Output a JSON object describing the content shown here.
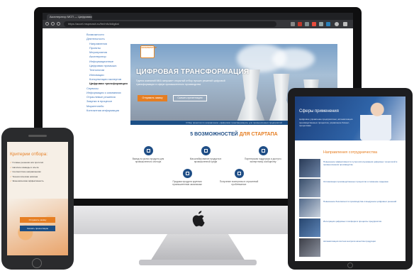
{
  "browser": {
    "tab_title": "Акселератор МСП — Цифровая трансф...",
    "url": "https://accel.mspmash.ru/fre/mfc/#digital"
  },
  "sidebar": {
    "items": [
      {
        "label": "Возможности",
        "sub": false
      },
      {
        "label": "Деятельность",
        "sub": false
      },
      {
        "label": "Направления",
        "sub": true
      },
      {
        "label": "Проекты",
        "sub": true
      },
      {
        "label": "Мероприятия",
        "sub": true
      },
      {
        "label": "Акселератор",
        "sub": true
      },
      {
        "label": "Информационные",
        "sub": true
      },
      {
        "label": "Цифровая промышл.",
        "sub": true
      },
      {
        "label": "Технологии",
        "sub": true
      },
      {
        "label": "Инновации",
        "sub": true
      },
      {
        "label": "Консультации экспертов",
        "sub": true
      },
      {
        "label": "Цифровая трансформация",
        "sub": true,
        "active": true
      },
      {
        "label": "Сервисы",
        "sub": false
      },
      {
        "label": "Информация о компаниях",
        "sub": false
      },
      {
        "label": "Отраслевые решения",
        "sub": false
      },
      {
        "label": "Закупки в процессе",
        "sub": false
      },
      {
        "label": "Маркетплейс",
        "sub": false
      },
      {
        "label": "Контактная информация",
        "sub": false
      }
    ]
  },
  "hero": {
    "logo_text": "АКСЕЛЕРАТОР",
    "title": "ЦИФРОВАЯ ТРАНСФОРМАЦИЯ",
    "description": "Группа компаний МКА запускает открытый отбор лучших решений цифровой трансформации в сфере промышленного производства",
    "btn_primary": "Отправить заявку",
    "btn_secondary": "Скачать презентацию",
    "strip": "Отбор проектов по направлению «Цифровая трансформация» для промышленных предприятий"
  },
  "features": {
    "title_main": "5 ВОЗМОЖНОСТЕЙ ",
    "title_accent": "ДЛЯ СТАРТАПА",
    "items": [
      {
        "icon": "chart-icon",
        "text": "Вывод на рынок продукта для промышленного сектора"
      },
      {
        "icon": "handshake-icon",
        "text": "Масштабирование продукта в промышленной среде"
      },
      {
        "icon": "rocket-icon",
        "text": "Партнерская поддержка и доступ к экспертному сообществу"
      },
      {
        "icon": "cart-icon",
        "text": "Продажа продукта крупным промышленным заказчикам"
      },
      {
        "icon": "target-icon",
        "text": "Получение экспертизы в отраслевой проблематике"
      }
    ]
  },
  "tablet": {
    "hero_title": "Сферы применения",
    "hero_list": "Цифровое управление предприятием, автоматизация производственных процессов, управление бизнес-процессами",
    "section_title": "Направления сотрудничества",
    "rows": [
      "Повышение эффективности путем использования цифровых технологий в промышленном производстве",
      "Оптимизация производственных процессов и снижение издержек",
      "Повышение безопасности производства и внедрение цифровых решений",
      "Интеграция цифровых платформ в процессы предприятия",
      "Автоматизация систем контроля качества продукции"
    ]
  },
  "phone": {
    "title": "Критерии отбора:",
    "criteria": [
      "Готовые решения или прототип",
      "Наличие команды и опыта",
      "Соответствие направлениям",
      "Технологическая новизна",
      "Экономическая эффективность"
    ],
    "btn_primary": "Отправить заявку",
    "btn_secondary": "Скачать презентацию"
  }
}
